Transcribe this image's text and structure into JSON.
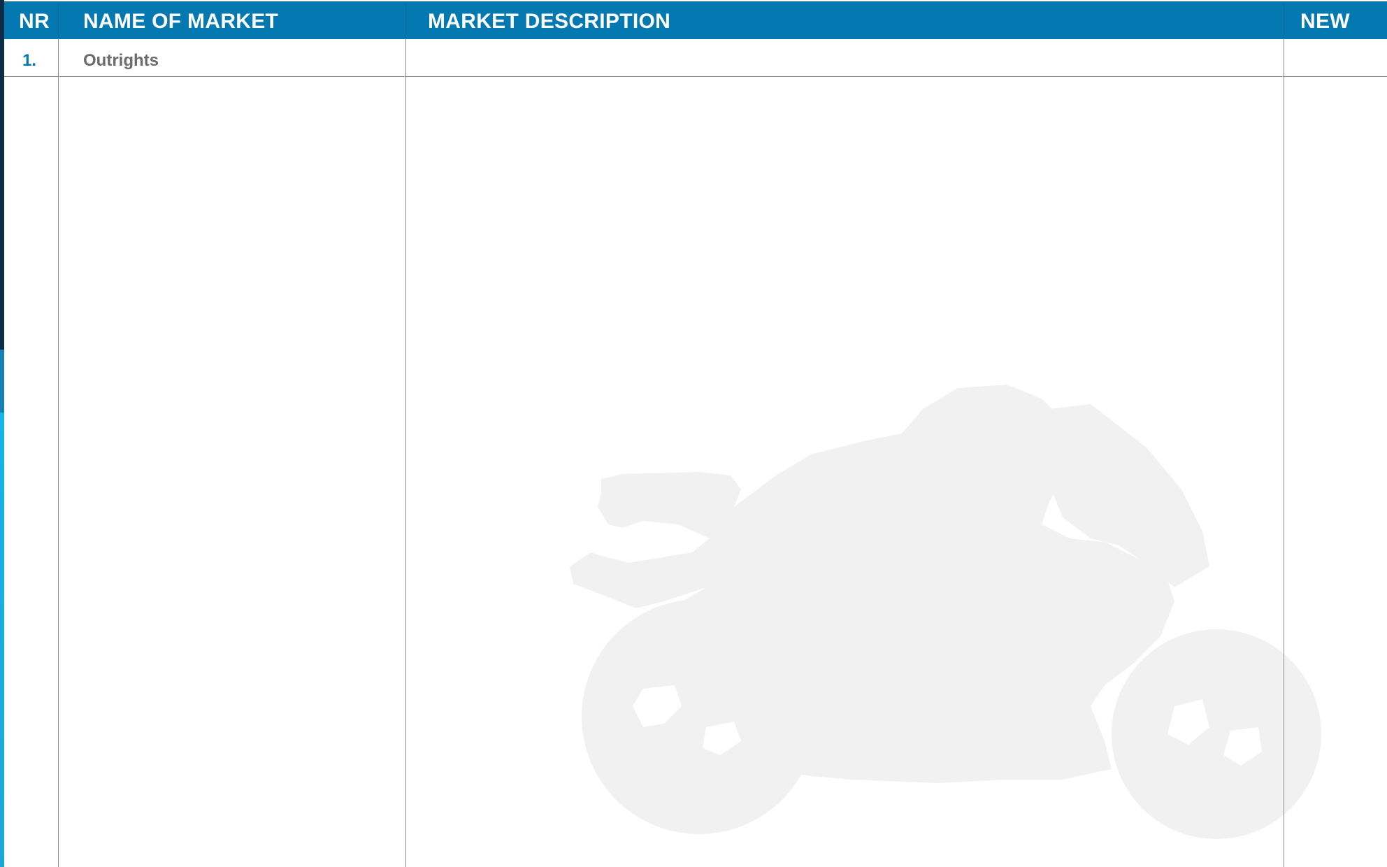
{
  "table": {
    "headers": {
      "nr": "NR",
      "name": "NAME OF MARKET",
      "description": "MARKET DESCRIPTION",
      "new": "NEW"
    },
    "rows": [
      {
        "nr": "1.",
        "name": "Outrights",
        "description": "",
        "new": ""
      }
    ]
  },
  "colors": {
    "header_background": "#0479b1",
    "header_text": "#ffffff",
    "row_number": "#0479b1",
    "row_name": "#6b6b6b",
    "grid_lines": "#8a8a8a",
    "watermark": "#f1f1f1"
  },
  "watermark": {
    "icon": "motorcycle-rider-silhouette-icon"
  }
}
